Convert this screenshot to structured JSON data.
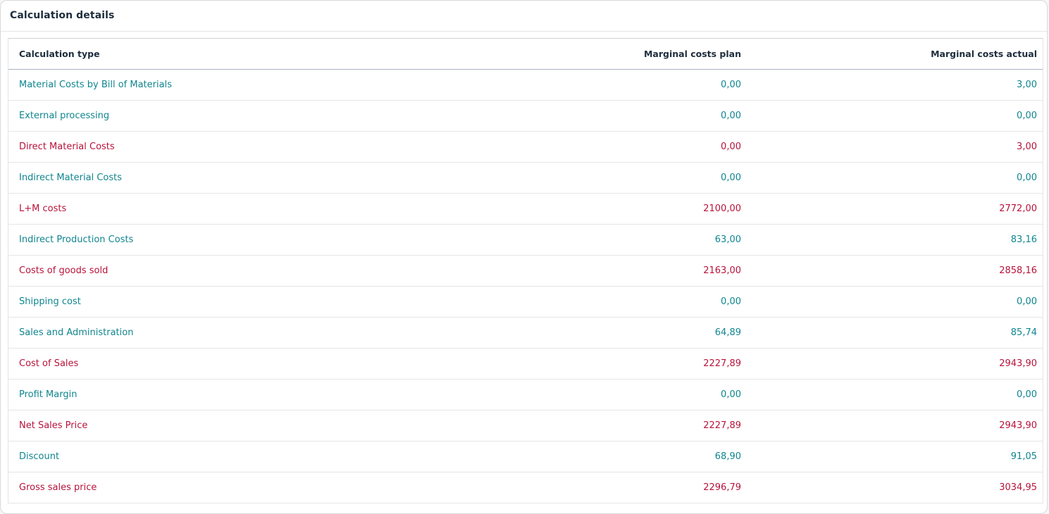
{
  "card": {
    "title": "Calculation details"
  },
  "table": {
    "headers": {
      "type": "Calculation type",
      "plan": "Marginal costs plan",
      "actual": "Marginal costs actual"
    },
    "rows": [
      {
        "type": "Material Costs by Bill of Materials",
        "plan": "0,00",
        "actual": "3,00",
        "style": "teal"
      },
      {
        "type": "External processing",
        "plan": "0,00",
        "actual": "0,00",
        "style": "teal"
      },
      {
        "type": "Direct Material Costs",
        "plan": "0,00",
        "actual": "3,00",
        "style": "red"
      },
      {
        "type": "Indirect Material Costs",
        "plan": "0,00",
        "actual": "0,00",
        "style": "teal"
      },
      {
        "type": "L+M costs",
        "plan": "2100,00",
        "actual": "2772,00",
        "style": "red"
      },
      {
        "type": "Indirect Production Costs",
        "plan": "63,00",
        "actual": "83,16",
        "style": "teal"
      },
      {
        "type": "Costs of goods sold",
        "plan": "2163,00",
        "actual": "2858,16",
        "style": "red"
      },
      {
        "type": "Shipping cost",
        "plan": "0,00",
        "actual": "0,00",
        "style": "teal"
      },
      {
        "type": "Sales and Administration",
        "plan": "64,89",
        "actual": "85,74",
        "style": "teal"
      },
      {
        "type": "Cost of Sales",
        "plan": "2227,89",
        "actual": "2943,90",
        "style": "red"
      },
      {
        "type": "Profit Margin",
        "plan": "0,00",
        "actual": "0,00",
        "style": "teal"
      },
      {
        "type": "Net Sales Price",
        "plan": "2227,89",
        "actual": "2943,90",
        "style": "red"
      },
      {
        "type": "Discount",
        "plan": "68,90",
        "actual": "91,05",
        "style": "teal"
      },
      {
        "type": "Gross sales price",
        "plan": "2296,79",
        "actual": "3034,95",
        "style": "red"
      }
    ]
  },
  "colors": {
    "teal": "#10868f",
    "red": "#b8133a",
    "header_text": "#1d2d3e"
  }
}
